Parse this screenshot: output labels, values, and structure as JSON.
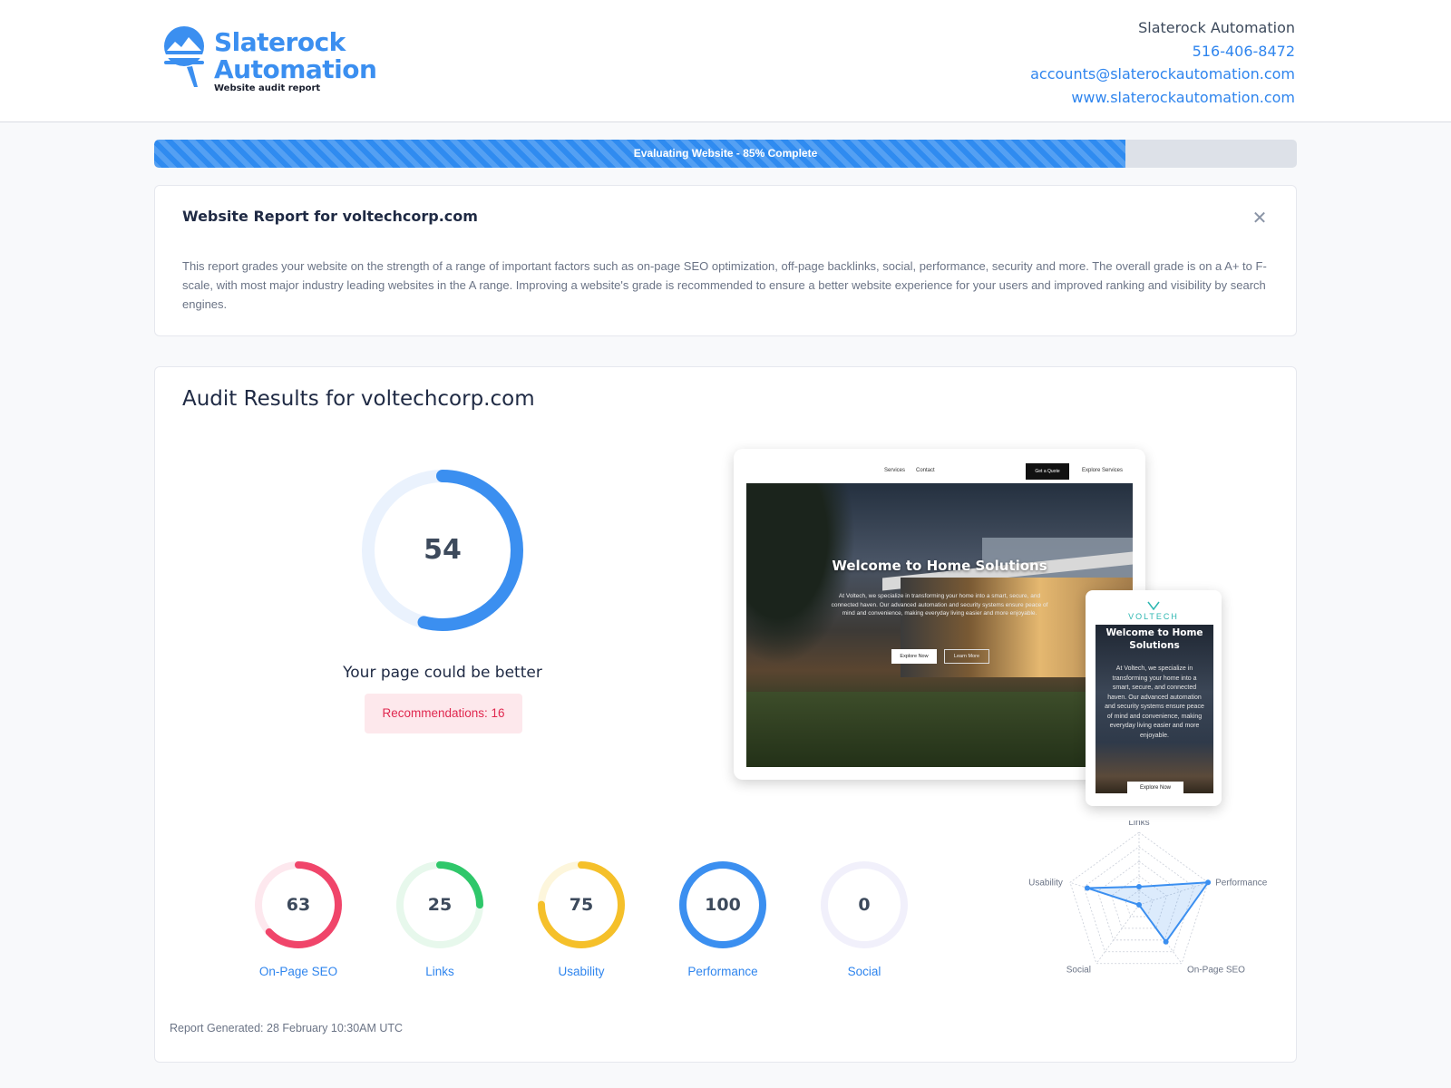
{
  "brand": {
    "line1": "Slaterock",
    "line2": "Automation",
    "tagline": "Website audit report",
    "color": "#3b8ff0"
  },
  "contact": {
    "company": "Slaterock Automation",
    "phone": "516-406-8472",
    "email": "accounts@slaterockautomation.com",
    "website": "www.slaterockautomation.com"
  },
  "progress": {
    "label": "Evaluating Website - 85% Complete",
    "percent": 85,
    "color": "#2f8bf0"
  },
  "report_card": {
    "title": "Website Report for voltechcorp.com",
    "close_icon": "close-icon",
    "description": "This report grades your website on the strength of a range of important factors such as on-page SEO optimization, off-page backlinks, social, performance, security and more. The overall grade is on a A+ to F-scale, with most major industry leading websites in the A range. Improving a website's grade is recommended to ensure a better website experience for your users and improved ranking and visibility by search engines."
  },
  "audit": {
    "title": "Audit Results for voltechcorp.com",
    "score": "54",
    "score_fraction": 0.54,
    "verdict": "Your page could be better",
    "recommendations": "Recommendations: 16"
  },
  "preview": {
    "desktop": {
      "nav_services": "Services",
      "nav_contact": "Contact",
      "nav_quote": "Get a Quote",
      "nav_explore": "Explore Services",
      "hero_title": "Welcome to  Home Solutions",
      "hero_text": "At Voltech, we specialize in transforming your home into a smart, secure, and connected haven. Our advanced automation and security systems ensure peace of mind and convenience, making everyday living easier and more enjoyable.",
      "btn_primary": "Explore Now",
      "btn_secondary": "Learn More"
    },
    "mobile": {
      "logo": "VOLTECH",
      "hero_title": "Welcome to Home Solutions",
      "hero_text": "At Voltech, we specialize in transforming your home into a smart, secure, and connected haven. Our advanced automation and security systems ensure peace of mind and convenience, making everyday living easier and more enjoyable.",
      "btn": "Explore Now"
    }
  },
  "categories": [
    {
      "label": "On-Page SEO",
      "value": "63",
      "fraction": 0.63,
      "color": "#f0456a",
      "track": "#fde8ee"
    },
    {
      "label": "Links",
      "value": "25",
      "fraction": 0.25,
      "color": "#2fc76a",
      "track": "#e7f8ec"
    },
    {
      "label": "Usability",
      "value": "75",
      "fraction": 0.75,
      "color": "#f5c02a",
      "track": "#fdf6dc"
    },
    {
      "label": "Performance",
      "value": "100",
      "fraction": 1.0,
      "color": "#3b8ff0",
      "track": "#e6f0fd"
    },
    {
      "label": "Social",
      "value": "0",
      "fraction": 0.0,
      "color": "#8b7bf0",
      "track": "#f1f0fb"
    }
  ],
  "chart_data": {
    "type": "radar",
    "axes": [
      "Links",
      "Performance",
      "On-Page SEO",
      "Social",
      "Usability"
    ],
    "values": [
      0.25,
      1.0,
      0.63,
      0.0,
      0.75
    ],
    "levels": 5,
    "color": "#3b8ff0"
  },
  "footer": {
    "generated": "Report Generated: 28 February 10:30AM UTC"
  }
}
